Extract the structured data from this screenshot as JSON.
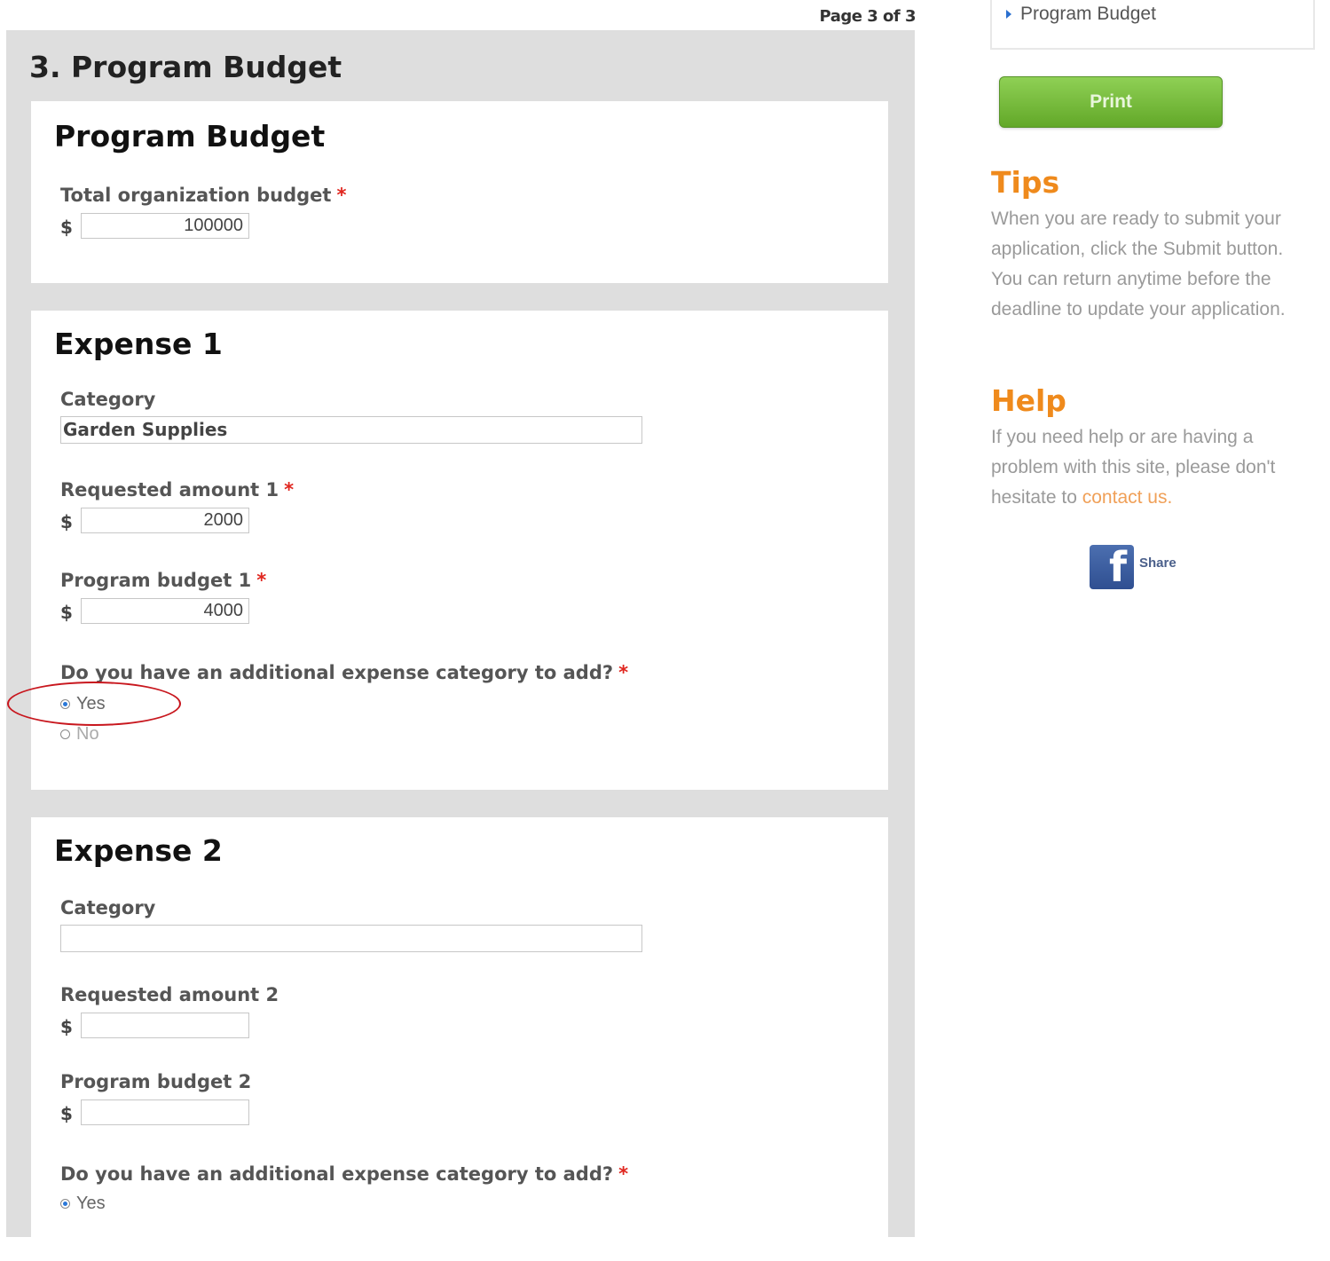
{
  "header": {
    "page_indicator": "Page 3 of 3"
  },
  "main": {
    "title": "3. Program Budget",
    "program_budget": {
      "heading": "Program Budget",
      "total_label": "Total organization budget",
      "required_mark": "*",
      "currency": "$",
      "total_value": "100000"
    },
    "expense1": {
      "heading": "Expense 1",
      "category_label": "Category",
      "category_value": "Garden Supplies",
      "requested_label": "Requested amount 1",
      "requested_value": "2000",
      "budget_label": "Program budget 1",
      "budget_value": "4000",
      "additional_question": "Do you have an additional expense category to add?",
      "yes_label": "Yes",
      "no_label": "No",
      "selected": "Yes"
    },
    "expense2": {
      "heading": "Expense 2",
      "category_label": "Category",
      "category_value": "",
      "requested_label": "Requested amount 2",
      "requested_value": "",
      "budget_label": "Program budget 2",
      "budget_value": "",
      "additional_question": "Do you have an additional expense category to add?",
      "yes_label": "Yes",
      "selected": "Yes"
    }
  },
  "sidebar": {
    "nav_item": "Program Budget",
    "print_label": "Print",
    "tips_heading": "Tips",
    "tips_text": "When you are ready to submit your application, click the Submit button. You can return anytime before the deadline to update your application.",
    "help_heading": "Help",
    "help_text": "If you need help or are having a problem with this site, please don't hesitate to",
    "help_link": "contact us.",
    "share_label": "Share",
    "share_icon_glyph": "f"
  },
  "colors": {
    "accent_orange": "#ef8a1c",
    "print_green": "#6db52f",
    "required_red": "#e0261f",
    "highlight_red": "#c8171e"
  },
  "icons": {
    "nav_bullet": "arrow-right-icon",
    "share": "facebook-icon"
  }
}
